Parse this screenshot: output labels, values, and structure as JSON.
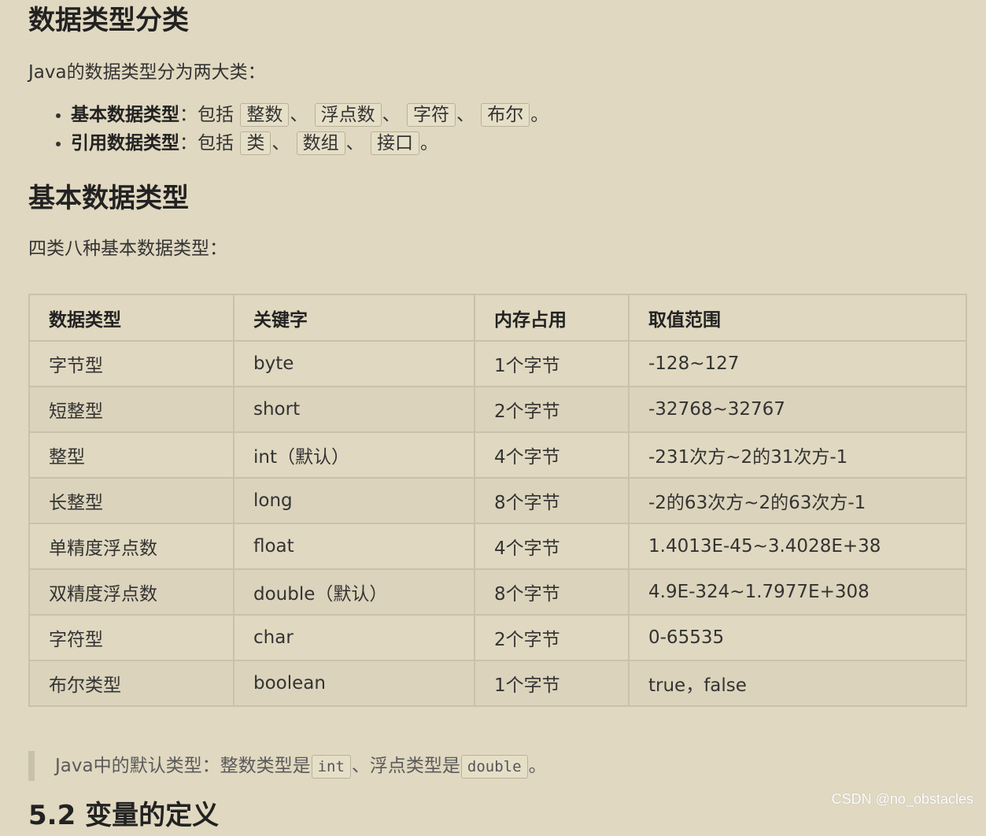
{
  "section1": {
    "title": "数据类型分类",
    "intro": "Java的数据类型分为两大类：",
    "items": [
      {
        "label": "基本数据类型",
        "sep": "：包括",
        "codes": [
          "整数",
          "浮点数",
          "字符",
          "布尔"
        ],
        "delim": "、",
        "end": "。"
      },
      {
        "label": "引用数据类型",
        "sep": "：包括",
        "codes": [
          "类",
          "数组",
          "接口"
        ],
        "delim": "、",
        "end": "。"
      }
    ]
  },
  "section2": {
    "title": "基本数据类型",
    "intro": "四类八种基本数据类型：",
    "table": {
      "headers": [
        "数据类型",
        "关键字",
        "内存占用",
        "取值范围"
      ],
      "rows": [
        [
          "字节型",
          "byte",
          "1个字节",
          "-128~127"
        ],
        [
          "短整型",
          "short",
          "2个字节",
          "-32768~32767"
        ],
        [
          "整型",
          "int（默认）",
          "4个字节",
          "-231次方~2的31次方-1"
        ],
        [
          "长整型",
          "long",
          "8个字节",
          "-2的63次方~2的63次方-1"
        ],
        [
          "单精度浮点数",
          "float",
          "4个字节",
          "1.4013E-45~3.4028E+38"
        ],
        [
          "双精度浮点数",
          "double（默认）",
          "8个字节",
          "4.9E-324~1.7977E+308"
        ],
        [
          "字符型",
          "char",
          "2个字节",
          "0-65535"
        ],
        [
          "布尔类型",
          "boolean",
          "1个字节",
          "true，false"
        ]
      ]
    },
    "note": {
      "prefix": "Java中的默认类型：整数类型是",
      "code1": "int",
      "middle": "、浮点类型是",
      "code2": "double",
      "suffix": "。"
    }
  },
  "section3": {
    "title": "5.2 变量的定义"
  },
  "watermark": "CSDN @no_obstacles"
}
